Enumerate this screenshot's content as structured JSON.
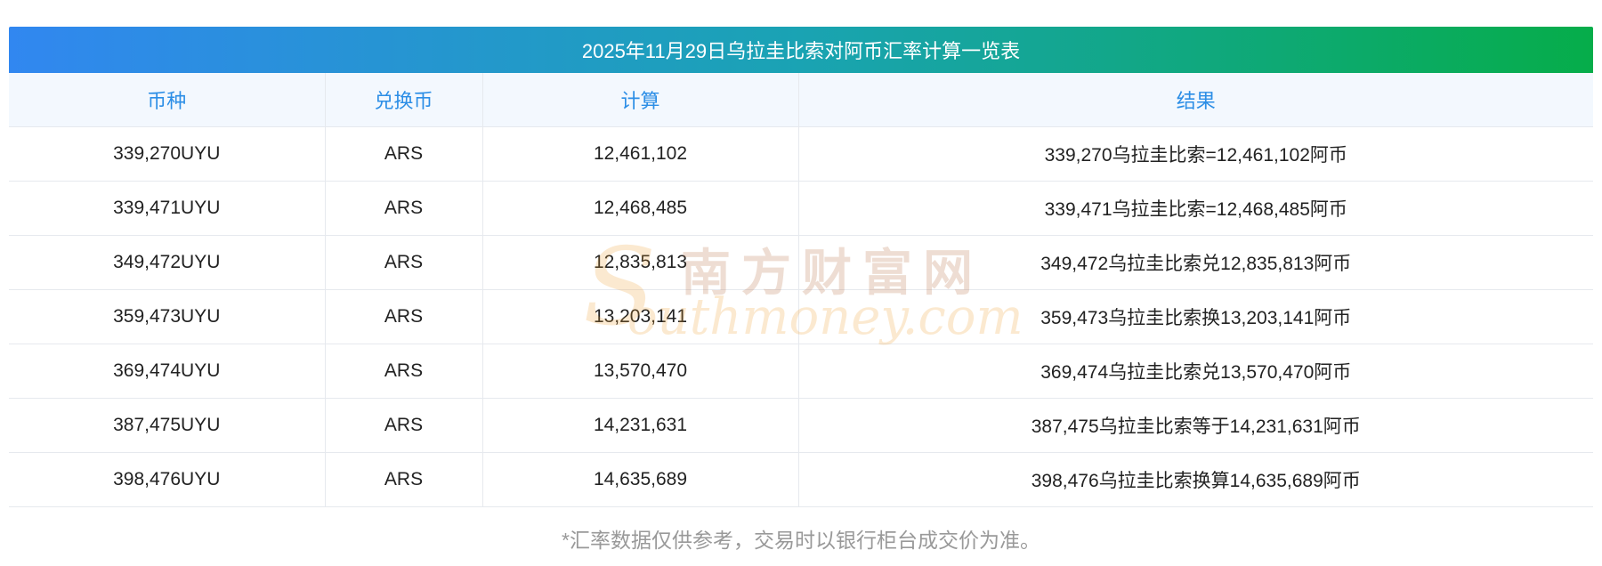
{
  "table": {
    "title": "2025年11月29日乌拉圭比索对阿币汇率计算一览表",
    "headers": [
      "币种",
      "兑换币",
      "计算",
      "结果"
    ],
    "rows": [
      [
        "339,270UYU",
        "ARS",
        "12,461,102",
        "339,270乌拉圭比索=12,461,102阿币"
      ],
      [
        "339,471UYU",
        "ARS",
        "12,468,485",
        "339,471乌拉圭比索=12,468,485阿币"
      ],
      [
        "349,472UYU",
        "ARS",
        "12,835,813",
        "349,472乌拉圭比索兑12,835,813阿币"
      ],
      [
        "359,473UYU",
        "ARS",
        "13,203,141",
        "359,473乌拉圭比索换13,203,141阿币"
      ],
      [
        "369,474UYU",
        "ARS",
        "13,570,470",
        "369,474乌拉圭比索兑13,570,470阿币"
      ],
      [
        "387,475UYU",
        "ARS",
        "14,231,631",
        "387,475乌拉圭比索等于14,231,631阿币"
      ],
      [
        "398,476UYU",
        "ARS",
        "14,635,689",
        "398,476乌拉圭比索换算14,635,689阿币"
      ]
    ]
  },
  "watermark": {
    "cn": "南方财富网",
    "en": "outhmoney.com",
    "s": "S"
  },
  "footnote": "*汇率数据仅供参考，交易时以银行柜台成交价为准。",
  "colors": {
    "title_gradient_start": "#3187f0",
    "title_gradient_end": "#06ad4a",
    "header_text": "#2c8ee6",
    "header_bg": "#f3f8fe",
    "footnote_text": "#999999"
  }
}
